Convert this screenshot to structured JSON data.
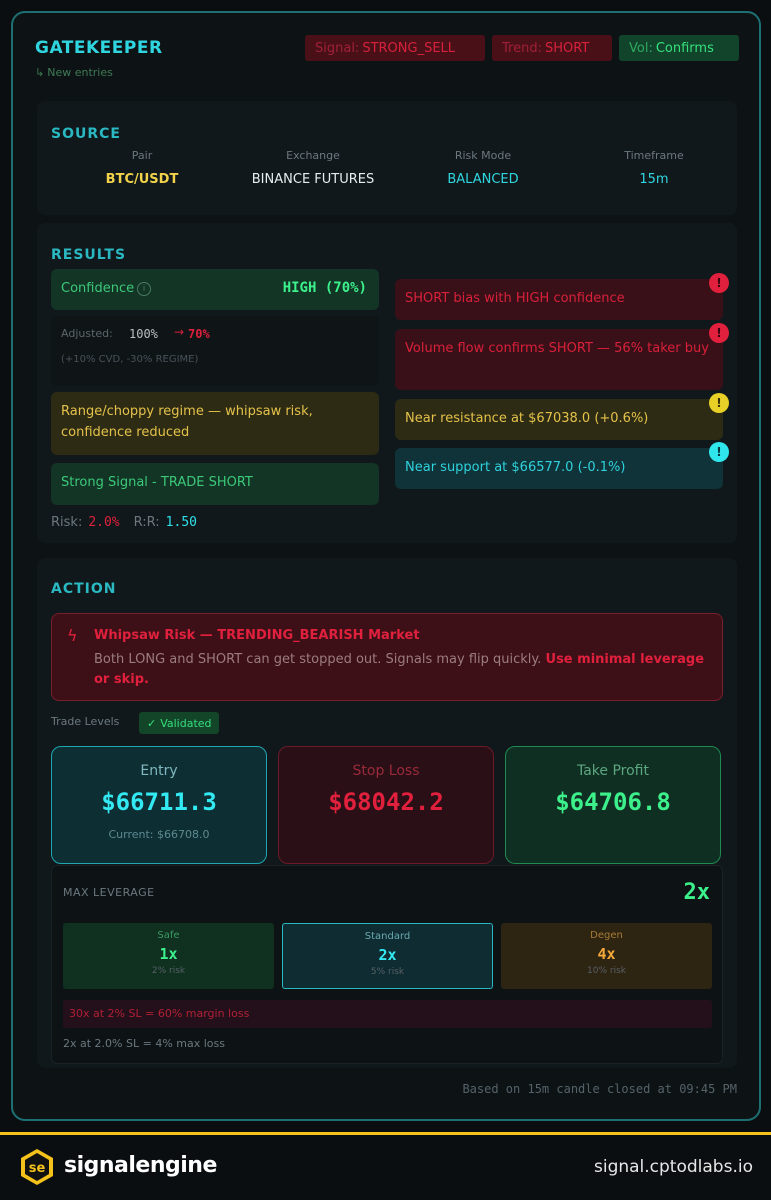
{
  "header": {
    "title": "GATEKEEPER",
    "subtitle": "New entries",
    "signal": {
      "key": "Signal:",
      "value": "STRONG_SELL"
    },
    "trend": {
      "key": "Trend:",
      "value": "SHORT"
    },
    "vol": {
      "key": "Vol:",
      "value": "Confirms"
    }
  },
  "source": {
    "title": "SOURCE",
    "columns": [
      {
        "label": "Pair",
        "value": "BTC/USDT",
        "color": "#f2d24a"
      },
      {
        "label": "Exchange",
        "value": "BINANCE FUTURES",
        "color": "#e8ecef"
      },
      {
        "label": "Risk Mode",
        "value": "BALANCED",
        "color": "#2fd6e0"
      },
      {
        "label": "Timeframe",
        "value": "15m",
        "color": "#2fd6e0"
      }
    ]
  },
  "results": {
    "title": "RESULTS",
    "confidence_label": "Confidence",
    "confidence_value": "HIGH (70%)",
    "adjusted_label": "Adjusted:",
    "adjusted_from": "100%",
    "adjusted_arrow": "→",
    "adjusted_to": "70%",
    "adjusted_note": "(+10% CVD, -30% REGIME)",
    "regime_msg": "Range/choppy regime — whipsaw risk, confidence reduced",
    "signal_msg": "Strong Signal - TRADE SHORT",
    "risk_label": "Risk:",
    "risk_value": "2.0%",
    "rr_label": "R:R:",
    "rr_value": "1.50",
    "alerts": [
      {
        "text": "SHORT bias with HIGH confidence",
        "level": "red"
      },
      {
        "text": "Volume flow confirms SHORT — 56% taker buy",
        "level": "red"
      },
      {
        "text": "Near resistance at $67038.0 (+0.6%)",
        "level": "yellow"
      },
      {
        "text": "Near support at $66577.0 (-0.1%)",
        "level": "cyan"
      }
    ]
  },
  "action": {
    "title": "ACTION",
    "warning_title": "Whipsaw Risk — TRENDING_BEARISH Market",
    "warning_body": "Both LONG and SHORT can get stopped out. Signals may flip quickly.",
    "warning_emphasis": "Use minimal leverage or skip.",
    "trade_levels_label": "Trade Levels",
    "validated_label": "Validated",
    "entry": {
      "label": "Entry",
      "value": "$66711.3",
      "current": "Current: $66708.0"
    },
    "stop_loss": {
      "label": "Stop Loss",
      "value": "$68042.2"
    },
    "take_profit": {
      "label": "Take Profit",
      "value": "$64706.8"
    },
    "leverage": {
      "label": "MAX LEVERAGE",
      "value": "2x",
      "options": [
        {
          "name": "Safe",
          "value": "1x",
          "risk": "2% risk"
        },
        {
          "name": "Standard",
          "value": "2x",
          "risk": "5% risk"
        },
        {
          "name": "Degen",
          "value": "4x",
          "risk": "10% risk"
        }
      ],
      "warning": "30x at 2% SL = 60% margin loss",
      "footer": "2x at 2.0% SL = 4% max loss"
    }
  },
  "footnote": "Based on 15m candle closed at 09:45 PM",
  "branding": {
    "logo_text": "se",
    "brand": "signalengine",
    "domain": "signal.cptodlabs.io"
  }
}
